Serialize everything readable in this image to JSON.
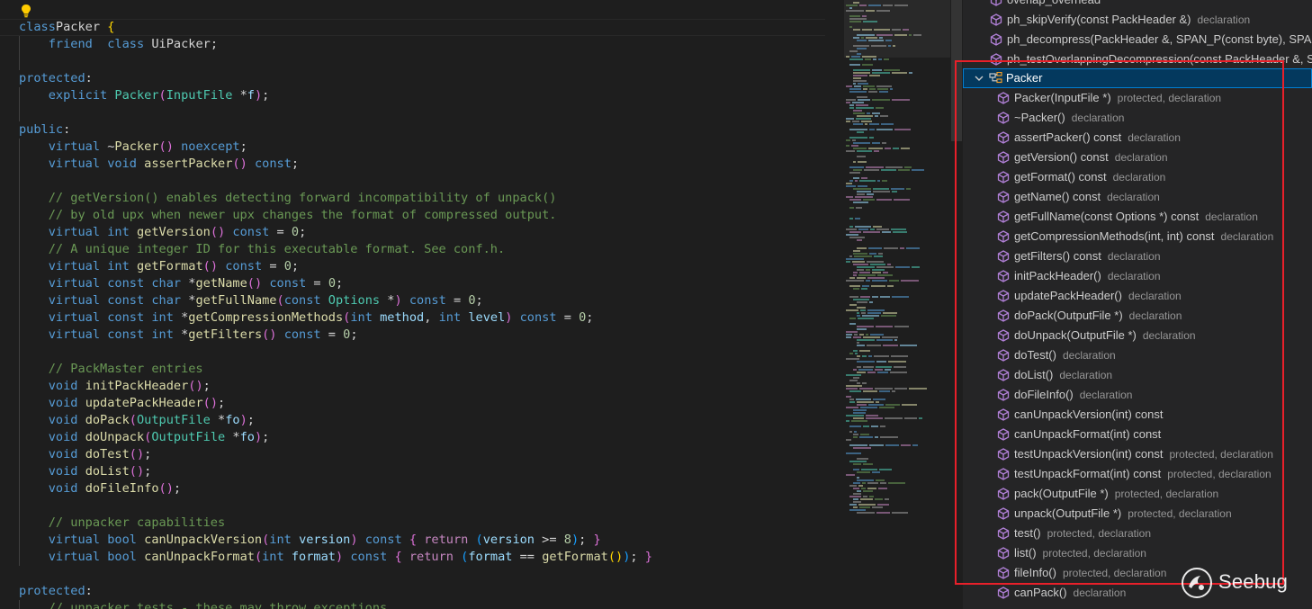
{
  "code_lines": [
    [
      [
        "kw",
        "class"
      ],
      [
        "",
        "Packer "
      ],
      [
        "b1",
        "{"
      ]
    ],
    [
      [
        "",
        "    "
      ],
      [
        "kw",
        "friend"
      ],
      [
        "",
        ""
      ],
      [
        "",
        ""
      ],
      [
        "",
        "  "
      ],
      [
        "kw",
        "class"
      ],
      [
        "",
        " UiPacker;"
      ]
    ],
    [],
    [
      [
        "kw",
        "protected"
      ],
      [
        "",
        ":"
      ]
    ],
    [
      [
        "",
        "    "
      ],
      [
        "kw",
        "explicit"
      ],
      [
        "",
        " "
      ],
      [
        "ty",
        "Packer"
      ],
      [
        "b2",
        "("
      ],
      [
        "ty",
        "InputFile"
      ],
      [
        "",
        " *"
      ],
      [
        "pa",
        "f"
      ],
      [
        "b2",
        ")"
      ],
      [
        "",
        ";"
      ]
    ],
    [],
    [
      [
        "kw",
        "public"
      ],
      [
        "",
        ":"
      ]
    ],
    [
      [
        "",
        "    "
      ],
      [
        "kw",
        "virtual"
      ],
      [
        "",
        " ~"
      ],
      [
        "fn",
        "Packer"
      ],
      [
        "b2",
        "()"
      ],
      [
        "",
        " "
      ],
      [
        "kw",
        "noexcept"
      ],
      [
        "",
        ";"
      ]
    ],
    [
      [
        "",
        "    "
      ],
      [
        "kw",
        "virtual"
      ],
      [
        "",
        " "
      ],
      [
        "kw",
        "void"
      ],
      [
        "",
        " "
      ],
      [
        "fn",
        "assertPacker"
      ],
      [
        "b2",
        "()"
      ],
      [
        "",
        " "
      ],
      [
        "kw",
        "const"
      ],
      [
        "",
        ";"
      ]
    ],
    [],
    [
      [
        "",
        "    "
      ],
      [
        "cm",
        "// getVersion() enables detecting forward incompatibility of unpack()"
      ]
    ],
    [
      [
        "",
        "    "
      ],
      [
        "cm",
        "// by old upx when newer upx changes the format of compressed output."
      ]
    ],
    [
      [
        "",
        "    "
      ],
      [
        "kw",
        "virtual"
      ],
      [
        "",
        " "
      ],
      [
        "kw",
        "int"
      ],
      [
        "",
        " "
      ],
      [
        "fn",
        "getVersion"
      ],
      [
        "b2",
        "()"
      ],
      [
        "",
        " "
      ],
      [
        "kw",
        "const"
      ],
      [
        "",
        " = "
      ],
      [
        "nu",
        "0"
      ],
      [
        "",
        ";"
      ]
    ],
    [
      [
        "",
        "    "
      ],
      [
        "cm",
        "// A unique integer ID for this executable format. See conf.h."
      ]
    ],
    [
      [
        "",
        "    "
      ],
      [
        "kw",
        "virtual"
      ],
      [
        "",
        " "
      ],
      [
        "kw",
        "int"
      ],
      [
        "",
        " "
      ],
      [
        "fn",
        "getFormat"
      ],
      [
        "b2",
        "()"
      ],
      [
        "",
        " "
      ],
      [
        "kw",
        "const"
      ],
      [
        "",
        " = "
      ],
      [
        "nu",
        "0"
      ],
      [
        "",
        ";"
      ]
    ],
    [
      [
        "",
        "    "
      ],
      [
        "kw",
        "virtual"
      ],
      [
        "",
        " "
      ],
      [
        "kw",
        "const"
      ],
      [
        "",
        " "
      ],
      [
        "kw",
        "char"
      ],
      [
        "",
        " *"
      ],
      [
        "fn",
        "getName"
      ],
      [
        "b2",
        "()"
      ],
      [
        "",
        " "
      ],
      [
        "kw",
        "const"
      ],
      [
        "",
        " = "
      ],
      [
        "nu",
        "0"
      ],
      [
        "",
        ";"
      ]
    ],
    [
      [
        "",
        "    "
      ],
      [
        "kw",
        "virtual"
      ],
      [
        "",
        " "
      ],
      [
        "kw",
        "const"
      ],
      [
        "",
        " "
      ],
      [
        "kw",
        "char"
      ],
      [
        "",
        " *"
      ],
      [
        "fn",
        "getFullName"
      ],
      [
        "b2",
        "("
      ],
      [
        "kw",
        "const"
      ],
      [
        "",
        " "
      ],
      [
        "ty",
        "Options"
      ],
      [
        "",
        " *"
      ],
      [
        "b2",
        ")"
      ],
      [
        "",
        " "
      ],
      [
        "kw",
        "const"
      ],
      [
        "",
        " = "
      ],
      [
        "nu",
        "0"
      ],
      [
        "",
        ";"
      ]
    ],
    [
      [
        "",
        "    "
      ],
      [
        "kw",
        "virtual"
      ],
      [
        "",
        " "
      ],
      [
        "kw",
        "const"
      ],
      [
        "",
        " "
      ],
      [
        "kw",
        "int"
      ],
      [
        "",
        " *"
      ],
      [
        "fn",
        "getCompressionMethods"
      ],
      [
        "b2",
        "("
      ],
      [
        "kw",
        "int"
      ],
      [
        "",
        " "
      ],
      [
        "pa",
        "method"
      ],
      [
        "",
        ", "
      ],
      [
        "kw",
        "int"
      ],
      [
        "",
        " "
      ],
      [
        "pa",
        "level"
      ],
      [
        "b2",
        ")"
      ],
      [
        "",
        " "
      ],
      [
        "kw",
        "const"
      ],
      [
        "",
        " = "
      ],
      [
        "nu",
        "0"
      ],
      [
        "",
        ";"
      ]
    ],
    [
      [
        "",
        "    "
      ],
      [
        "kw",
        "virtual"
      ],
      [
        "",
        " "
      ],
      [
        "kw",
        "const"
      ],
      [
        "",
        " "
      ],
      [
        "kw",
        "int"
      ],
      [
        "",
        " *"
      ],
      [
        "fn",
        "getFilters"
      ],
      [
        "b2",
        "()"
      ],
      [
        "",
        " "
      ],
      [
        "kw",
        "const"
      ],
      [
        "",
        " = "
      ],
      [
        "nu",
        "0"
      ],
      [
        "",
        ";"
      ]
    ],
    [],
    [
      [
        "",
        "    "
      ],
      [
        "cm",
        "// PackMaster entries"
      ]
    ],
    [
      [
        "",
        "    "
      ],
      [
        "kw",
        "void"
      ],
      [
        "",
        " "
      ],
      [
        "fn",
        "initPackHeader"
      ],
      [
        "b2",
        "()"
      ],
      [
        "",
        ";"
      ]
    ],
    [
      [
        "",
        "    "
      ],
      [
        "kw",
        "void"
      ],
      [
        "",
        " "
      ],
      [
        "fn",
        "updatePackHeader"
      ],
      [
        "b2",
        "()"
      ],
      [
        "",
        ";"
      ]
    ],
    [
      [
        "",
        "    "
      ],
      [
        "kw",
        "void"
      ],
      [
        "",
        " "
      ],
      [
        "fn",
        "doPack"
      ],
      [
        "b2",
        "("
      ],
      [
        "ty",
        "OutputFile"
      ],
      [
        "",
        " *"
      ],
      [
        "pa",
        "fo"
      ],
      [
        "b2",
        ")"
      ],
      [
        "",
        ";"
      ]
    ],
    [
      [
        "",
        "    "
      ],
      [
        "kw",
        "void"
      ],
      [
        "",
        " "
      ],
      [
        "fn",
        "doUnpack"
      ],
      [
        "b2",
        "("
      ],
      [
        "ty",
        "OutputFile"
      ],
      [
        "",
        " *"
      ],
      [
        "pa",
        "fo"
      ],
      [
        "b2",
        ")"
      ],
      [
        "",
        ";"
      ]
    ],
    [
      [
        "",
        "    "
      ],
      [
        "kw",
        "void"
      ],
      [
        "",
        " "
      ],
      [
        "fn",
        "doTest"
      ],
      [
        "b2",
        "()"
      ],
      [
        "",
        ";"
      ]
    ],
    [
      [
        "",
        "    "
      ],
      [
        "kw",
        "void"
      ],
      [
        "",
        " "
      ],
      [
        "fn",
        "doList"
      ],
      [
        "b2",
        "()"
      ],
      [
        "",
        ";"
      ]
    ],
    [
      [
        "",
        "    "
      ],
      [
        "kw",
        "void"
      ],
      [
        "",
        " "
      ],
      [
        "fn",
        "doFileInfo"
      ],
      [
        "b2",
        "()"
      ],
      [
        "",
        ";"
      ]
    ],
    [],
    [
      [
        "",
        "    "
      ],
      [
        "cm",
        "// unpacker capabilities"
      ]
    ],
    [
      [
        "",
        "    "
      ],
      [
        "kw",
        "virtual"
      ],
      [
        "",
        " "
      ],
      [
        "kw",
        "bool"
      ],
      [
        "",
        " "
      ],
      [
        "fn",
        "canUnpackVersion"
      ],
      [
        "b2",
        "("
      ],
      [
        "kw",
        "int"
      ],
      [
        "",
        " "
      ],
      [
        "pa",
        "version"
      ],
      [
        "b2",
        ")"
      ],
      [
        "",
        " "
      ],
      [
        "kw",
        "const"
      ],
      [
        "",
        " "
      ],
      [
        "b2",
        "{"
      ],
      [
        "",
        " "
      ],
      [
        "ctl",
        "return"
      ],
      [
        "",
        " "
      ],
      [
        "b3",
        "("
      ],
      [
        "pa",
        "version"
      ],
      [
        "",
        " >= "
      ],
      [
        "nu",
        "8"
      ],
      [
        "b3",
        ")"
      ],
      [
        "",
        "; "
      ],
      [
        "b2",
        "}"
      ]
    ],
    [
      [
        "",
        "    "
      ],
      [
        "kw",
        "virtual"
      ],
      [
        "",
        " "
      ],
      [
        "kw",
        "bool"
      ],
      [
        "",
        " "
      ],
      [
        "fn",
        "canUnpackFormat"
      ],
      [
        "b2",
        "("
      ],
      [
        "kw",
        "int"
      ],
      [
        "",
        " "
      ],
      [
        "pa",
        "format"
      ],
      [
        "b2",
        ")"
      ],
      [
        "",
        " "
      ],
      [
        "kw",
        "const"
      ],
      [
        "",
        " "
      ],
      [
        "b2",
        "{"
      ],
      [
        "",
        " "
      ],
      [
        "ctl",
        "return"
      ],
      [
        "",
        " "
      ],
      [
        "b3",
        "("
      ],
      [
        "pa",
        "format"
      ],
      [
        "",
        " == "
      ],
      [
        "fn",
        "getFormat"
      ],
      [
        "b1",
        "()"
      ],
      [
        "b3",
        ")"
      ],
      [
        "",
        "; "
      ],
      [
        "b2",
        "}"
      ]
    ],
    [],
    [
      [
        "kw",
        "protected"
      ],
      [
        "",
        ":"
      ]
    ],
    [
      [
        "",
        "    "
      ],
      [
        "cm",
        "// unpacker tests - these may throw exceptions"
      ]
    ]
  ],
  "outline": {
    "top_items": [
      {
        "name": "overlap_overhead",
        "detail": ""
      },
      {
        "name": "ph_skipVerify(const PackHeader &)",
        "detail": "declaration"
      },
      {
        "name": "ph_decompress(PackHeader &, SPAN_P(const byte), SPAN_P",
        "detail": ""
      },
      {
        "name": "ph_testOverlappingDecompression(const PackHeader &, SP",
        "detail": ""
      }
    ],
    "class_name": "Packer",
    "members": [
      {
        "name": "Packer(InputFile *)",
        "detail": "protected, declaration"
      },
      {
        "name": "~Packer()",
        "detail": "declaration"
      },
      {
        "name": "assertPacker() const",
        "detail": "declaration"
      },
      {
        "name": "getVersion() const",
        "detail": "declaration"
      },
      {
        "name": "getFormat() const",
        "detail": "declaration"
      },
      {
        "name": "getName() const",
        "detail": "declaration"
      },
      {
        "name": "getFullName(const Options *) const",
        "detail": "declaration"
      },
      {
        "name": "getCompressionMethods(int, int) const",
        "detail": "declaration"
      },
      {
        "name": "getFilters() const",
        "detail": "declaration"
      },
      {
        "name": "initPackHeader()",
        "detail": "declaration"
      },
      {
        "name": "updatePackHeader()",
        "detail": "declaration"
      },
      {
        "name": "doPack(OutputFile *)",
        "detail": "declaration"
      },
      {
        "name": "doUnpack(OutputFile *)",
        "detail": "declaration"
      },
      {
        "name": "doTest()",
        "detail": "declaration"
      },
      {
        "name": "doList()",
        "detail": "declaration"
      },
      {
        "name": "doFileInfo()",
        "detail": "declaration"
      },
      {
        "name": "canUnpackVersion(int) const",
        "detail": ""
      },
      {
        "name": "canUnpackFormat(int) const",
        "detail": ""
      },
      {
        "name": "testUnpackVersion(int) const",
        "detail": "protected, declaration"
      },
      {
        "name": "testUnpackFormat(int) const",
        "detail": "protected, declaration"
      },
      {
        "name": "pack(OutputFile *)",
        "detail": "protected, declaration"
      },
      {
        "name": "unpack(OutputFile *)",
        "detail": "protected, declaration"
      },
      {
        "name": "test()",
        "detail": "protected, declaration"
      },
      {
        "name": "list()",
        "detail": "protected, declaration"
      },
      {
        "name": "fileInfo()",
        "detail": "protected, declaration"
      },
      {
        "name": "canPack()",
        "detail": "declaration"
      }
    ]
  },
  "icons": {
    "lightbulb": "lightbulb-icon",
    "method": "method-cube-icon",
    "class": "class-icon",
    "chevron": "chevron-down-icon",
    "watermark_logo": "seebug-logo"
  },
  "colors": {
    "highlight_box": "#e8202a",
    "method_icon": "#b180d7",
    "class_icon": "#ee9d28",
    "selection": "#04395e"
  },
  "watermark": {
    "text": "Seebug"
  }
}
